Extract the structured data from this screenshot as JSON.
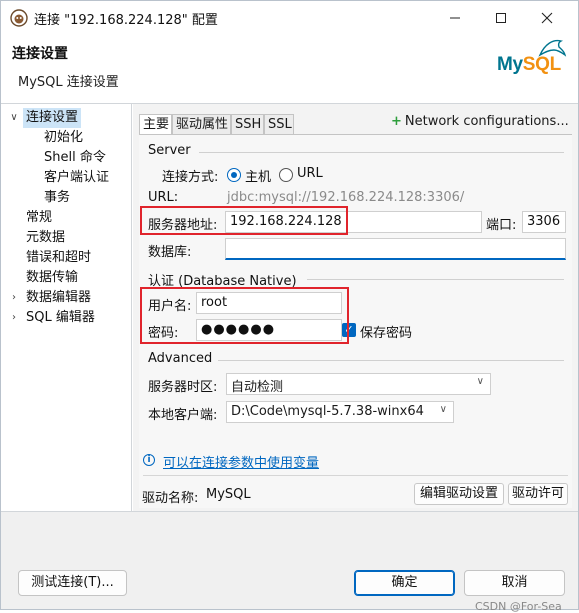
{
  "window": {
    "title": "连接 \"192.168.224.128\" 配置"
  },
  "header": {
    "title": "连接设置",
    "subtitle": "MySQL 连接设置",
    "logo_my": "My",
    "logo_sql": "SQL"
  },
  "tree": {
    "items": [
      {
        "label": "连接设置",
        "expanded": true
      },
      {
        "label": "初始化"
      },
      {
        "label": "Shell 命令"
      },
      {
        "label": "客户端认证"
      },
      {
        "label": "事务"
      },
      {
        "label": "常规"
      },
      {
        "label": "元数据"
      },
      {
        "label": "错误和超时"
      },
      {
        "label": "数据传输"
      },
      {
        "label": "数据编辑器"
      },
      {
        "label": "SQL 编辑器"
      }
    ]
  },
  "tabs": [
    {
      "label": "主要"
    },
    {
      "label": "驱动属性"
    },
    {
      "label": "SSH"
    },
    {
      "label": "SSL"
    }
  ],
  "network_config": "Network configurations...",
  "server": {
    "group_title": "Server",
    "connect_method_label": "连接方式:",
    "opt_host": "主机",
    "opt_url": "URL",
    "url_label": "URL:",
    "url_value": "jdbc:mysql://192.168.224.128:3306/",
    "host_label": "服务器地址:",
    "host_value": "192.168.224.128",
    "port_label": "端口:",
    "port_value": "3306",
    "db_label": "数据库:",
    "db_value": ""
  },
  "auth": {
    "group_title": "认证 (Database Native)",
    "user_label": "用户名:",
    "user_value": "root",
    "pwd_label": "密码:",
    "pwd_value": "●●●●●●",
    "save_pwd_label": "保存密码"
  },
  "advanced": {
    "group_title": "Advanced",
    "tz_label": "服务器时区:",
    "tz_value": "自动检测",
    "client_label": "本地客户端:",
    "client_value": "D:\\Code\\mysql-5.7.38-winx64"
  },
  "vars_link": "可以在连接参数中使用变量",
  "driver": {
    "label": "驱动名称:",
    "value": "MySQL",
    "edit_button": "编辑驱动设置",
    "license_button": "驱动许可"
  },
  "footer": {
    "test_button": "测试连接(T)...",
    "ok_button": "确定",
    "cancel_button": "取消",
    "watermark": "CSDN @For-Sea"
  }
}
